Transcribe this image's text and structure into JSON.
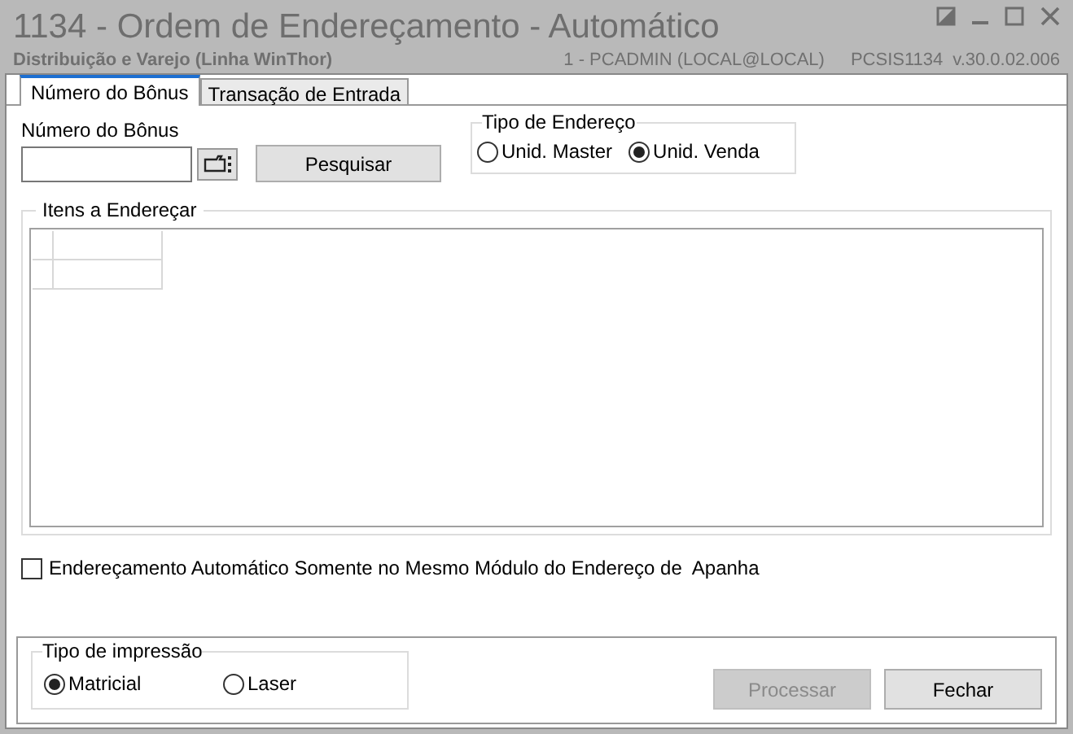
{
  "window": {
    "title": "1134 - Ordem de Endereçamento - Automático",
    "subtitle": "Distribuição e Varejo (Linha WinThor)",
    "user": "1 - PCADMIN (LOCAL@LOCAL)",
    "program": "PCSIS1134",
    "version": "v.30.0.02.006"
  },
  "tabs": [
    {
      "label": "Número do Bônus",
      "selected": true
    },
    {
      "label": "Transação de Entrada",
      "selected": false
    }
  ],
  "bonus": {
    "label": "Número do Bônus",
    "search_button": "Pesquisar"
  },
  "tipo_endereco": {
    "title": "Tipo de Endereço",
    "options": [
      {
        "label": "Unid. Master",
        "selected": false
      },
      {
        "label": "Unid. Venda",
        "selected": true
      }
    ]
  },
  "itens": {
    "title": "Itens a Endereçar"
  },
  "auto_checkbox": {
    "label": "Endereçamento Automático Somente no Mesmo Módulo do Endereço de  Apanha",
    "checked": false
  },
  "tipo_impressao": {
    "title": "Tipo de impressão",
    "options": [
      {
        "label": "Matricial",
        "selected": true
      },
      {
        "label": "Laser",
        "selected": false
      }
    ]
  },
  "buttons": [
    {
      "label": "Processar",
      "disabled": true
    },
    {
      "label": "Fechar",
      "disabled": false
    }
  ]
}
